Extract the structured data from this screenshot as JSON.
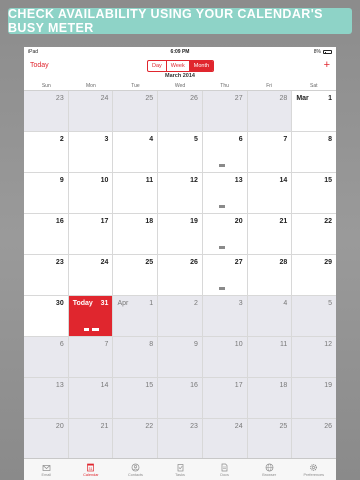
{
  "banner": {
    "text": "CHECK AVAILABILITY USING YOUR CALENDAR'S BUSY METER"
  },
  "status": {
    "device": "iPad",
    "time": "6:09 PM",
    "battery": "8%"
  },
  "nav": {
    "today_label": "Today",
    "add_label": "+",
    "segments": [
      {
        "label": "Day",
        "active": false
      },
      {
        "label": "Week",
        "active": false
      },
      {
        "label": "Month",
        "active": true
      }
    ]
  },
  "calendar": {
    "month_title": "March 2014",
    "weekdays": [
      "Sun",
      "Mon",
      "Tue",
      "Wed",
      "Thu",
      "Fri",
      "Sat"
    ],
    "weeks": [
      [
        {
          "d": "23",
          "o": true
        },
        {
          "d": "24",
          "o": true
        },
        {
          "d": "25",
          "o": true
        },
        {
          "d": "26",
          "o": true
        },
        {
          "d": "27",
          "o": true
        },
        {
          "d": "28",
          "o": true
        },
        {
          "d": "1",
          "m": "Mar"
        }
      ],
      [
        {
          "d": "2"
        },
        {
          "d": "3"
        },
        {
          "d": "4"
        },
        {
          "d": "5"
        },
        {
          "d": "6",
          "busy": 1
        },
        {
          "d": "7"
        },
        {
          "d": "8"
        }
      ],
      [
        {
          "d": "9"
        },
        {
          "d": "10"
        },
        {
          "d": "11"
        },
        {
          "d": "12"
        },
        {
          "d": "13",
          "busy": 1
        },
        {
          "d": "14"
        },
        {
          "d": "15"
        }
      ],
      [
        {
          "d": "16"
        },
        {
          "d": "17"
        },
        {
          "d": "18"
        },
        {
          "d": "19"
        },
        {
          "d": "20",
          "busy": 1
        },
        {
          "d": "21"
        },
        {
          "d": "22"
        }
      ],
      [
        {
          "d": "23"
        },
        {
          "d": "24"
        },
        {
          "d": "25"
        },
        {
          "d": "26"
        },
        {
          "d": "27",
          "busy": 1
        },
        {
          "d": "28"
        },
        {
          "d": "29"
        }
      ],
      [
        {
          "d": "30"
        },
        {
          "d": "31",
          "today": true,
          "m": "Today",
          "busy": 2
        },
        {
          "d": "1",
          "o": true,
          "m": "Apr"
        },
        {
          "d": "2",
          "o": true
        },
        {
          "d": "3",
          "o": true
        },
        {
          "d": "4",
          "o": true
        },
        {
          "d": "5",
          "o": true
        }
      ],
      [
        {
          "d": "6",
          "o": true
        },
        {
          "d": "7",
          "o": true
        },
        {
          "d": "8",
          "o": true
        },
        {
          "d": "9",
          "o": true
        },
        {
          "d": "10",
          "o": true
        },
        {
          "d": "11",
          "o": true
        },
        {
          "d": "12",
          "o": true
        }
      ],
      [
        {
          "d": "13",
          "o": true
        },
        {
          "d": "14",
          "o": true
        },
        {
          "d": "15",
          "o": true
        },
        {
          "d": "16",
          "o": true
        },
        {
          "d": "17",
          "o": true
        },
        {
          "d": "18",
          "o": true
        },
        {
          "d": "19",
          "o": true
        }
      ],
      [
        {
          "d": "20",
          "o": true
        },
        {
          "d": "21",
          "o": true
        },
        {
          "d": "22",
          "o": true
        },
        {
          "d": "23",
          "o": true
        },
        {
          "d": "24",
          "o": true
        },
        {
          "d": "25",
          "o": true
        },
        {
          "d": "26",
          "o": true
        }
      ]
    ]
  },
  "tabs": [
    {
      "label": "Email",
      "icon": "mail-icon",
      "active": false
    },
    {
      "label": "Calendar",
      "icon": "calendar-icon",
      "active": true,
      "badge": "31"
    },
    {
      "label": "Contacts",
      "icon": "contacts-icon",
      "active": false
    },
    {
      "label": "Tasks",
      "icon": "tasks-icon",
      "active": false
    },
    {
      "label": "Docs",
      "icon": "docs-icon",
      "active": false
    },
    {
      "label": "Browser",
      "icon": "browser-icon",
      "active": false
    },
    {
      "label": "Preferences",
      "icon": "gear-icon",
      "active": false
    }
  ],
  "colors": {
    "accent": "#e0262e",
    "banner": "#8ed3c7",
    "busy": "#8a8a8a"
  }
}
